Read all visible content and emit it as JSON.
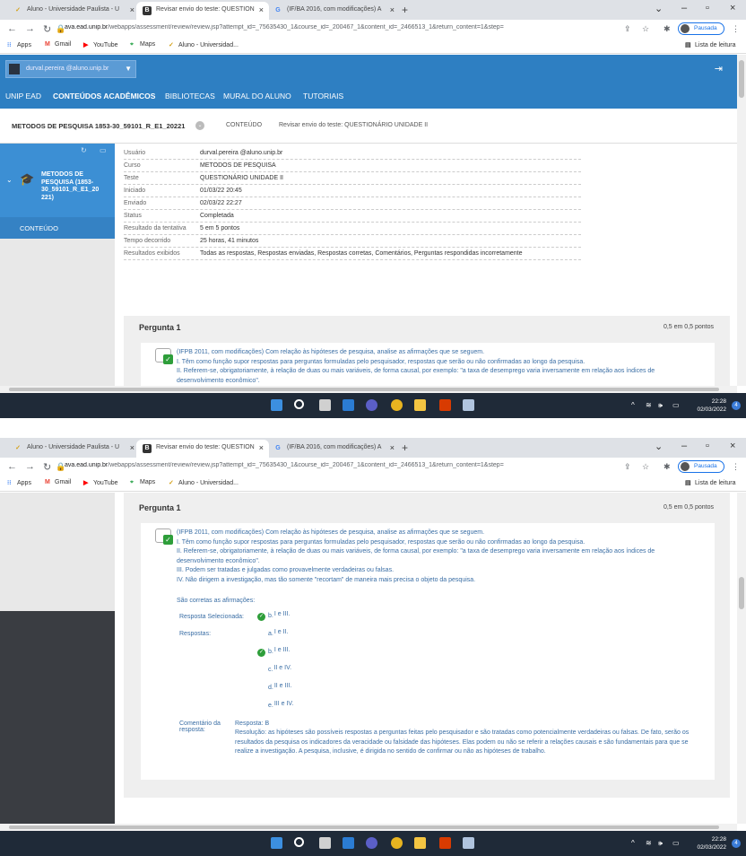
{
  "browser": {
    "tabs": [
      {
        "title": "Aluno - Universidade Paulista - U",
        "active": false
      },
      {
        "title": "Revisar envio do teste: QUESTION",
        "active": true
      },
      {
        "title": "(IF/BA 2016, com modificações) A",
        "active": false
      }
    ],
    "url_host": "ava.ead.unip.br",
    "url_path": "/webapps/assessment/review/review.jsp?attempt_id=_75635430_1&course_id=_200467_1&content_id=_2466513_1&return_content=1&step=",
    "profile_label": "Pausada",
    "bookmarks": [
      "Apps",
      "Gmail",
      "YouTube",
      "Maps",
      "Aluno - Universidad..."
    ],
    "reading_list": "Lista de leitura"
  },
  "header": {
    "user_email": "durval.pereira @aluno.unip.br",
    "nav": [
      "UNIP EAD",
      "CONTEÚDOS ACADÊMICOS",
      "BIBLIOTECAS",
      "MURAL DO ALUNO",
      "TUTORIAIS"
    ]
  },
  "breadcrumb": {
    "course": "METODOS DE PESQUISA 1853-30_59101_R_E1_20221",
    "section": "CONTEÚDO",
    "page": "Revisar envio do teste: QUESTIONÁRIO UNIDADE II"
  },
  "leftmenu": {
    "course_title": "METODOS DE PESQUISA (1853-30_59101_R_E1_20 221)",
    "item": "CONTEÚDO"
  },
  "attempt_info": [
    {
      "label": "Usuário",
      "value": "durval.pereira @aluno.unip.br"
    },
    {
      "label": "Curso",
      "value": "METODOS DE PESQUISA"
    },
    {
      "label": "Teste",
      "value": "QUESTIONÁRIO UNIDADE II"
    },
    {
      "label": "Iniciado",
      "value": "01/03/22 20:45"
    },
    {
      "label": "Enviado",
      "value": "02/03/22 22:27"
    },
    {
      "label": "Status",
      "value": "Completada"
    },
    {
      "label": "Resultado da tentativa",
      "value": "5 em 5 pontos"
    },
    {
      "label": "Tempo decorrido",
      "value": "25 horas, 41 minutos"
    },
    {
      "label": "Resultados exibidos",
      "value": "Todas as respostas, Respostas enviadas, Respostas corretas, Comentários, Perguntas respondidas incorretamente"
    }
  ],
  "question": {
    "title": "Pergunta 1",
    "points": "0,5 em 0,5 pontos",
    "text": [
      "(IFPB 2011, com modificações) Com relação às hipóteses de pesquisa, analise as afirmações que se seguem.",
      "I. Têm como função supor respostas para perguntas formuladas pelo pesquisador, respostas que serão ou não confirmadas ao longo da pesquisa.",
      "II. Referem-se, obrigatoriamente, à relação de duas ou mais variáveis, de forma causal, por exemplo: \"a taxa de desemprego varia inversamente em relação aos índices de desenvolvimento econômico\".",
      "III. Podem ser tratadas e julgadas como provavelmente verdadeiras ou falsas.",
      "IV. Não dirigem a investigação, mas tão somente \"recortam\" de maneira mais precisa o objeto da pesquisa."
    ],
    "prompt": "São corretas as afirmações:",
    "selected_label": "Resposta Selecionada:",
    "selected": {
      "letter": "b.",
      "text": "I e III."
    },
    "answers_label": "Respostas:",
    "answers": [
      {
        "letter": "a.",
        "text": "I e II.",
        "correct": false
      },
      {
        "letter": "b.",
        "text": "I e III.",
        "correct": true
      },
      {
        "letter": "c.",
        "text": "II e IV.",
        "correct": false
      },
      {
        "letter": "d.",
        "text": "II e III.",
        "correct": false
      },
      {
        "letter": "e.",
        "text": "III e IV.",
        "correct": false
      }
    ],
    "comment_label_1": "Comentário da",
    "comment_label_2": "resposta:",
    "comment_answer": "Resposta: B",
    "comment_text": "Resolução: as hipóteses são possíveis respostas a perguntas feitas pelo pesquisador e são tratadas como potencialmente verdadeiras ou falsas. De fato, serão os resultados da pesquisa os indicadores da veracidade ou falsidade das hipóteses. Elas podem ou não se referir a relações causais e são fundamentais para que se realize a investigação. A pesquisa, inclusive, é dirigida no sentido de confirmar ou não as hipóteses de trabalho."
  },
  "taskbar": {
    "time": "22:28",
    "date": "02/03/2022",
    "badge": "4"
  }
}
